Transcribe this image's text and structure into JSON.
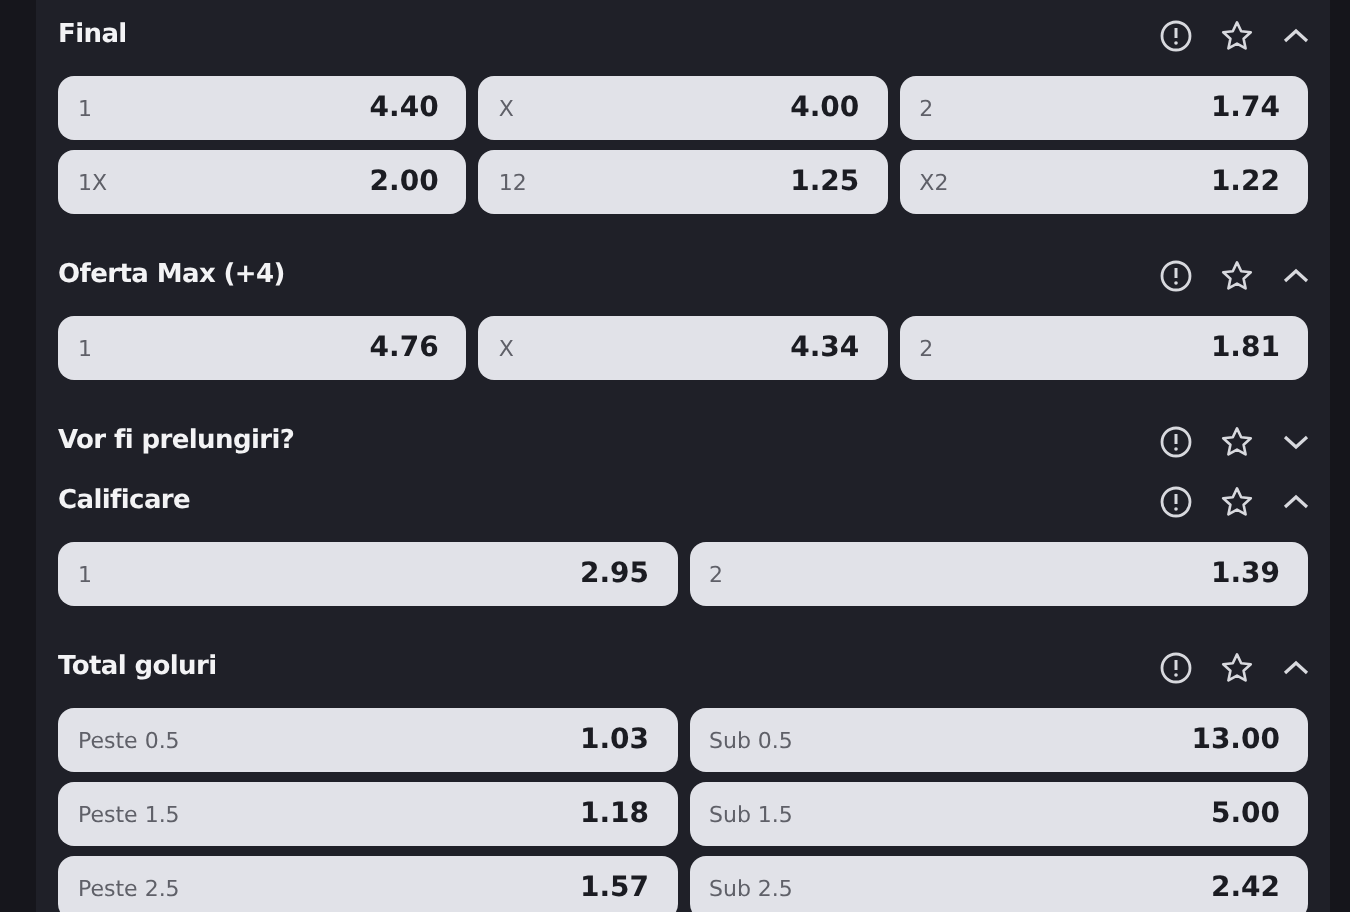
{
  "markets": [
    {
      "title": "Final",
      "expanded": true,
      "rows": [
        [
          {
            "label": "1",
            "odds": "4.40"
          },
          {
            "label": "X",
            "odds": "4.00"
          },
          {
            "label": "2",
            "odds": "1.74"
          }
        ],
        [
          {
            "label": "1X",
            "odds": "2.00"
          },
          {
            "label": "12",
            "odds": "1.25"
          },
          {
            "label": "X2",
            "odds": "1.22"
          }
        ]
      ]
    },
    {
      "title": "Oferta Max (+4)",
      "expanded": true,
      "rows": [
        [
          {
            "label": "1",
            "odds": "4.76"
          },
          {
            "label": "X",
            "odds": "4.34"
          },
          {
            "label": "2",
            "odds": "1.81"
          }
        ]
      ]
    },
    {
      "title": "Vor fi prelungiri?",
      "expanded": false
    },
    {
      "title": "Calificare",
      "expanded": true,
      "rows": [
        [
          {
            "label": "1",
            "odds": "2.95"
          },
          {
            "label": "2",
            "odds": "1.39"
          }
        ]
      ]
    },
    {
      "title": "Total goluri",
      "expanded": true,
      "rows": [
        [
          {
            "label": "Peste 0.5",
            "odds": "1.03"
          },
          {
            "label": "Sub 0.5",
            "odds": "13.00"
          }
        ],
        [
          {
            "label": "Peste 1.5",
            "odds": "1.18"
          },
          {
            "label": "Sub 1.5",
            "odds": "5.00"
          }
        ],
        [
          {
            "label": "Peste 2.5",
            "odds": "1.57"
          },
          {
            "label": "Sub 2.5",
            "odds": "2.42"
          }
        ]
      ]
    }
  ]
}
